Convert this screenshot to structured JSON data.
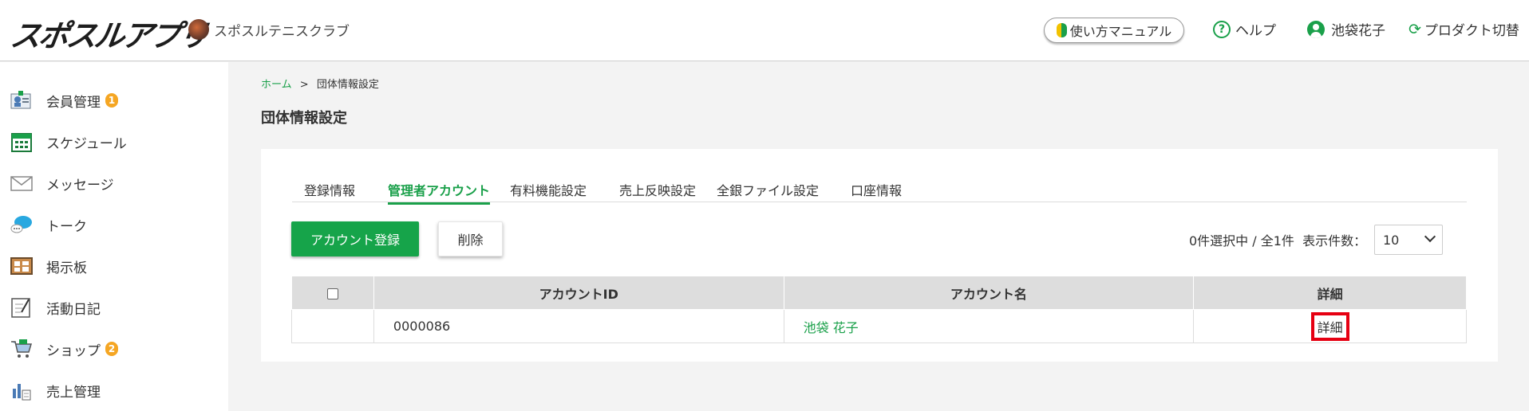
{
  "header": {
    "logo": "スポスルアプリ",
    "club_name": "スポスルテニスクラブ",
    "manual_label": "使い方マニュアル",
    "help_label": "ヘルプ",
    "user_label": "池袋花子",
    "switch_label": "プロダクト切替"
  },
  "sidebar": {
    "items": [
      {
        "label": "会員管理",
        "badge": "1"
      },
      {
        "label": "スケジュール"
      },
      {
        "label": "メッセージ"
      },
      {
        "label": "トーク"
      },
      {
        "label": "掲示板"
      },
      {
        "label": "活動日記"
      },
      {
        "label": "ショップ",
        "badge": "2"
      },
      {
        "label": "売上管理"
      }
    ]
  },
  "breadcrumb": {
    "home": "ホーム",
    "separator": ">",
    "current": "団体情報設定"
  },
  "page_title": "団体情報設定",
  "tabs": [
    {
      "label": "登録情報"
    },
    {
      "label": "管理者アカウント",
      "active": true
    },
    {
      "label": "有料機能設定"
    },
    {
      "label": "売上反映設定"
    },
    {
      "label": "全銀ファイル設定"
    },
    {
      "label": "口座情報"
    }
  ],
  "actions": {
    "register_label": "アカウント登録",
    "delete_label": "削除"
  },
  "selection_status": "0件選択中 / 全1件  表示件数：",
  "per_page": "10",
  "table": {
    "headers": [
      "アカウントID",
      "アカウント名",
      "詳細"
    ],
    "rows": [
      {
        "id": "0000086",
        "name": "池袋 花子",
        "detail": "詳細"
      }
    ]
  },
  "colors": {
    "brand_green": "#16a44a",
    "badge_orange": "#f5a623",
    "highlight_red": "#e60012"
  }
}
